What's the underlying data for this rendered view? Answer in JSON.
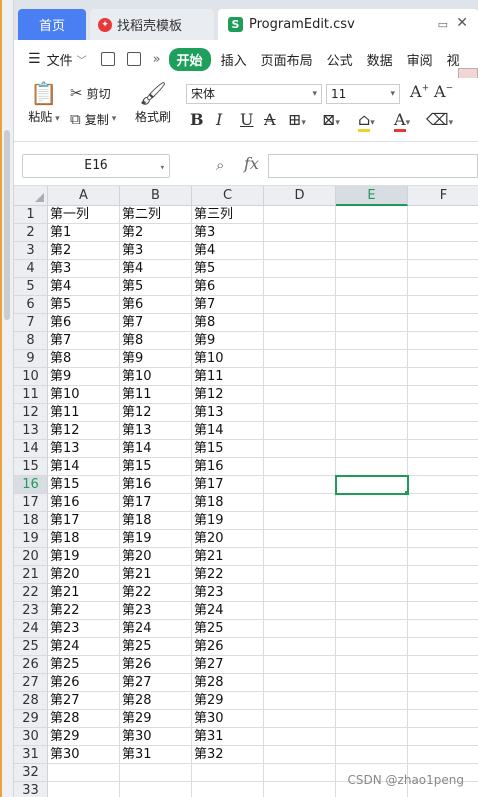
{
  "tabs": {
    "home": "首页",
    "template": "找稻壳模板",
    "file": "ProgramEdit.csv"
  },
  "menu": {
    "file": "文件",
    "start": "开始",
    "insert": "插入",
    "page_layout": "页面布局",
    "formula": "公式",
    "data": "数据",
    "review": "审阅",
    "view": "视"
  },
  "toolbar": {
    "paste": "粘贴",
    "cut": "剪切",
    "copy": "复制",
    "format_painter": "格式刷",
    "font_name": "宋体",
    "font_size": "11"
  },
  "formula_bar": {
    "cell_ref": "E16",
    "fx": "fx",
    "value": ""
  },
  "sheet": {
    "columns": [
      "A",
      "B",
      "C",
      "D",
      "E",
      "F"
    ],
    "selected_column": "E",
    "selected_row": 16,
    "rows": [
      [
        "第一列",
        "第二列",
        "第三列"
      ],
      [
        "第1",
        "第2",
        "第3"
      ],
      [
        "第2",
        "第3",
        "第4"
      ],
      [
        "第3",
        "第4",
        "第5"
      ],
      [
        "第4",
        "第5",
        "第6"
      ],
      [
        "第5",
        "第6",
        "第7"
      ],
      [
        "第6",
        "第7",
        "第8"
      ],
      [
        "第7",
        "第8",
        "第9"
      ],
      [
        "第8",
        "第9",
        "第10"
      ],
      [
        "第9",
        "第10",
        "第11"
      ],
      [
        "第10",
        "第11",
        "第12"
      ],
      [
        "第11",
        "第12",
        "第13"
      ],
      [
        "第12",
        "第13",
        "第14"
      ],
      [
        "第13",
        "第14",
        "第15"
      ],
      [
        "第14",
        "第15",
        "第16"
      ],
      [
        "第15",
        "第16",
        "第17"
      ],
      [
        "第16",
        "第17",
        "第18"
      ],
      [
        "第17",
        "第18",
        "第19"
      ],
      [
        "第18",
        "第19",
        "第20"
      ],
      [
        "第19",
        "第20",
        "第21"
      ],
      [
        "第20",
        "第21",
        "第22"
      ],
      [
        "第21",
        "第22",
        "第23"
      ],
      [
        "第22",
        "第23",
        "第24"
      ],
      [
        "第23",
        "第24",
        "第25"
      ],
      [
        "第24",
        "第25",
        "第26"
      ],
      [
        "第25",
        "第26",
        "第27"
      ],
      [
        "第26",
        "第27",
        "第28"
      ],
      [
        "第27",
        "第28",
        "第29"
      ],
      [
        "第28",
        "第29",
        "第30"
      ],
      [
        "第29",
        "第30",
        "第31"
      ],
      [
        "第30",
        "第31",
        "第32"
      ],
      [
        "",
        "",
        ""
      ],
      [
        "",
        "",
        ""
      ]
    ]
  },
  "watermark": "CSDN @zhao1peng",
  "colors": {
    "accent_green": "#1f9a57",
    "home_tab_blue": "#4a7ff3"
  }
}
